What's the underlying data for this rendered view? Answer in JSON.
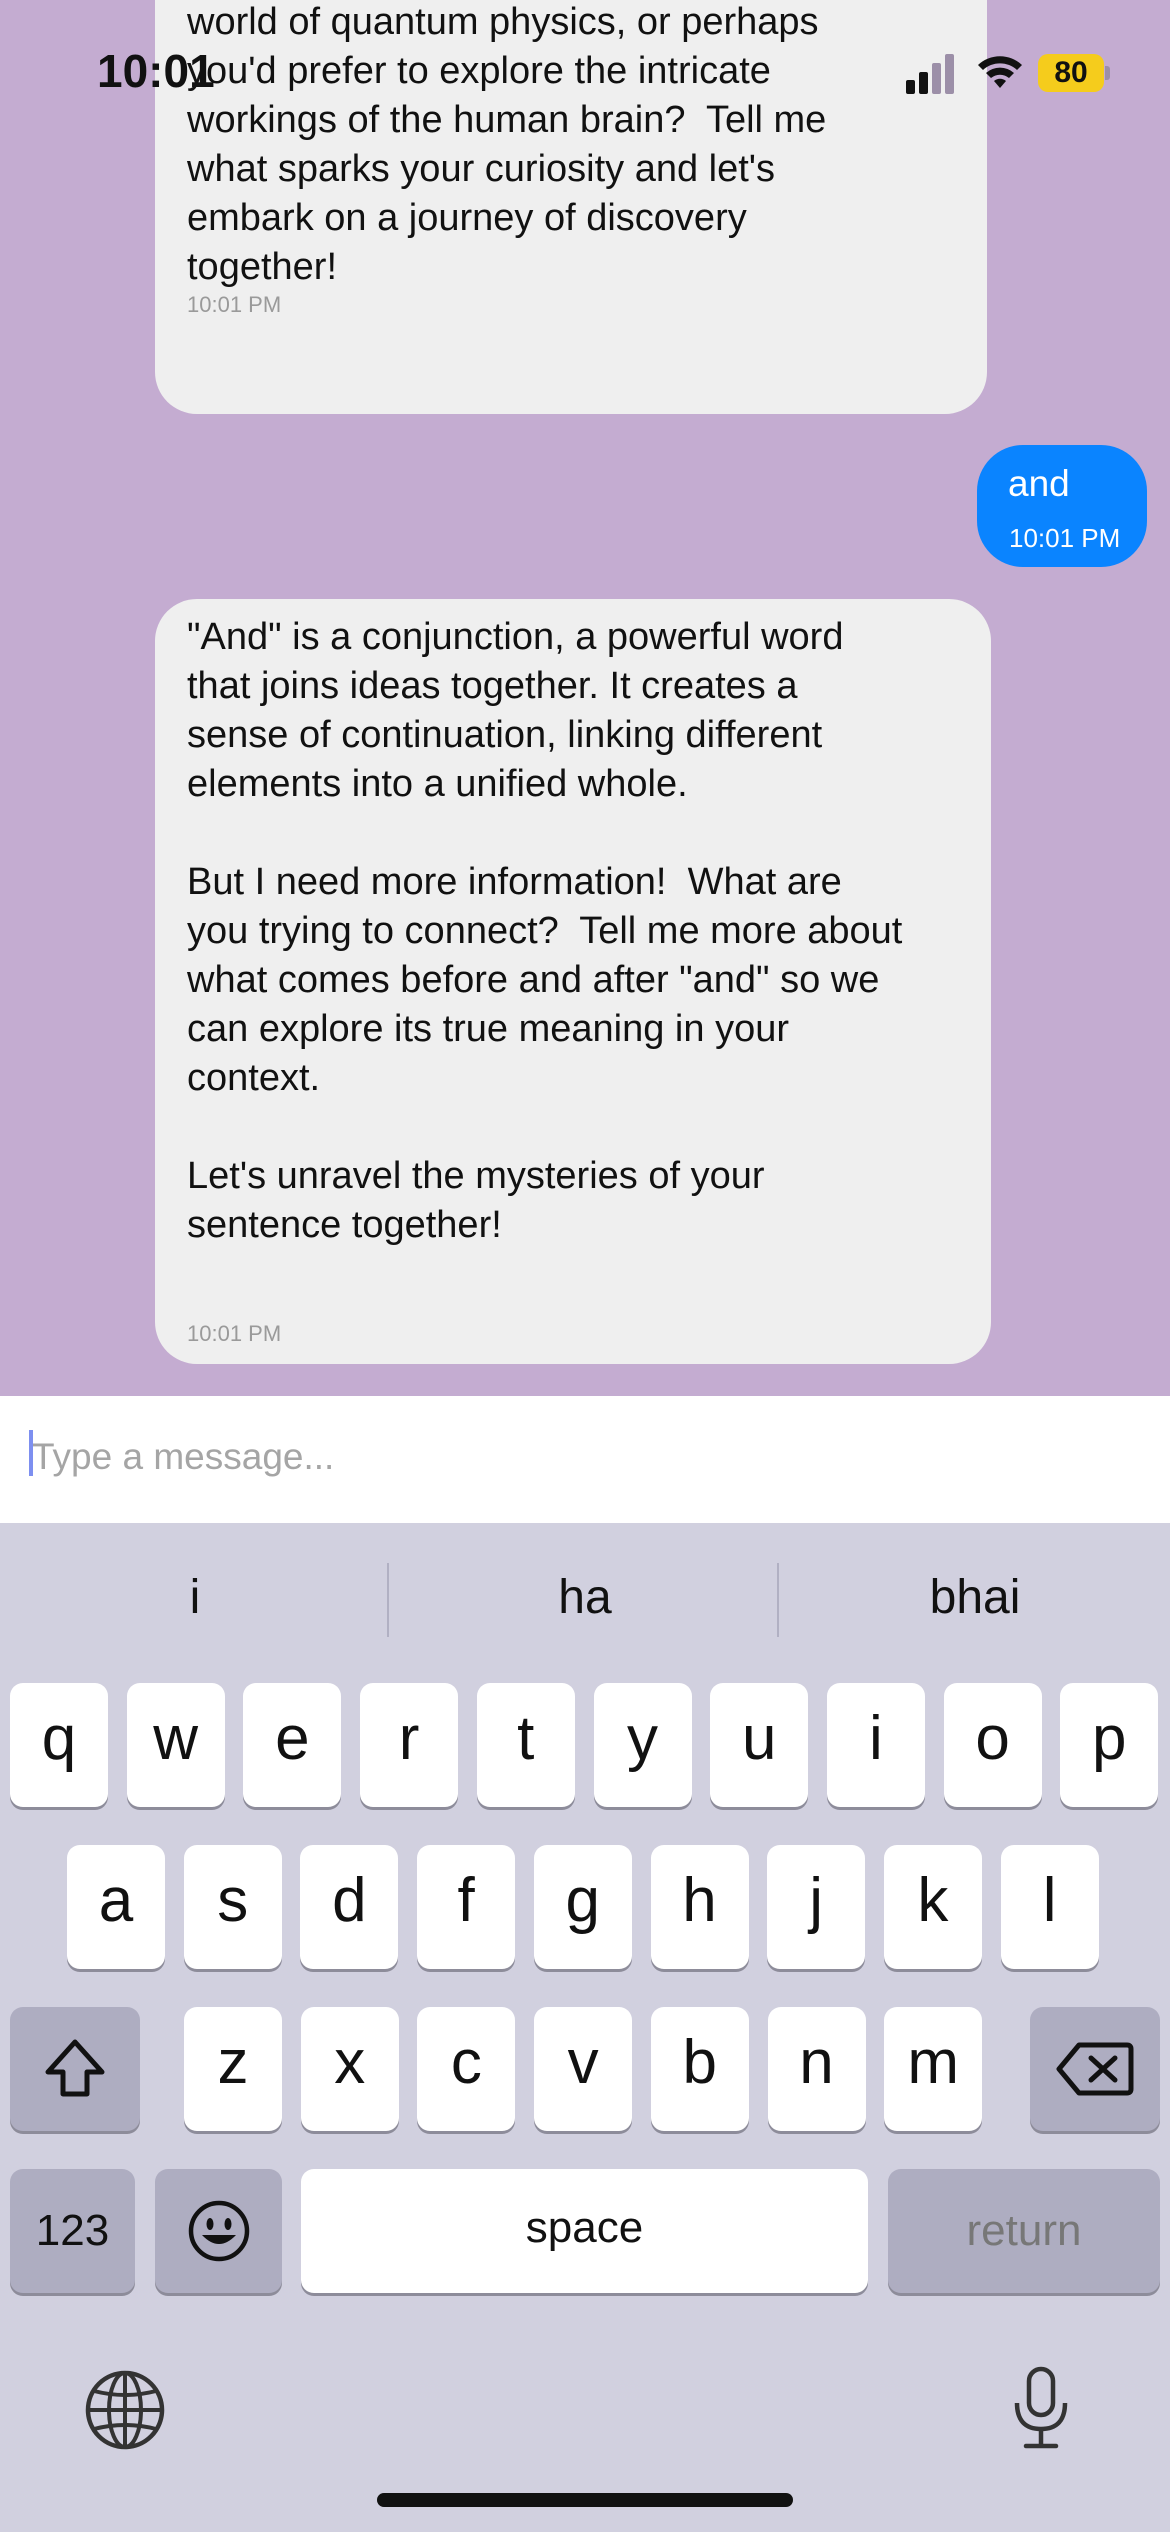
{
  "status_bar": {
    "time": "10:01",
    "battery": "80"
  },
  "messages": [
    {
      "role": "assistant",
      "text": "world of quantum physics, or perhaps\nyou'd prefer to explore the intricate\nworkings of the human brain?  Tell me\nwhat sparks your curiosity and let's\nembark on a journey of discovery\ntogether!",
      "time": "10:01 PM"
    },
    {
      "role": "user",
      "text": "and",
      "time": "10:01 PM"
    },
    {
      "role": "assistant",
      "text": "\"And\" is a conjunction, a powerful word\nthat joins ideas together. It creates a\nsense of continuation, linking different\nelements into a unified whole.\n\nBut I need more information!  What are\nyou trying to connect?  Tell me more about\nwhat comes before and after \"and\" so we\ncan explore its true meaning in your\ncontext.\n\nLet's unravel the mysteries of your\nsentence together!",
      "time": "10:01 PM"
    }
  ],
  "composer": {
    "placeholder": "Type a message..."
  },
  "keyboard": {
    "suggestions": [
      "i",
      "ha",
      "bhai"
    ],
    "row1": [
      "q",
      "w",
      "e",
      "r",
      "t",
      "y",
      "u",
      "i",
      "o",
      "p"
    ],
    "row2": [
      "a",
      "s",
      "d",
      "f",
      "g",
      "h",
      "j",
      "k",
      "l"
    ],
    "row3": [
      "z",
      "x",
      "c",
      "v",
      "b",
      "n",
      "m"
    ],
    "numbers_label": "123",
    "space_label": "space",
    "return_label": "return"
  }
}
